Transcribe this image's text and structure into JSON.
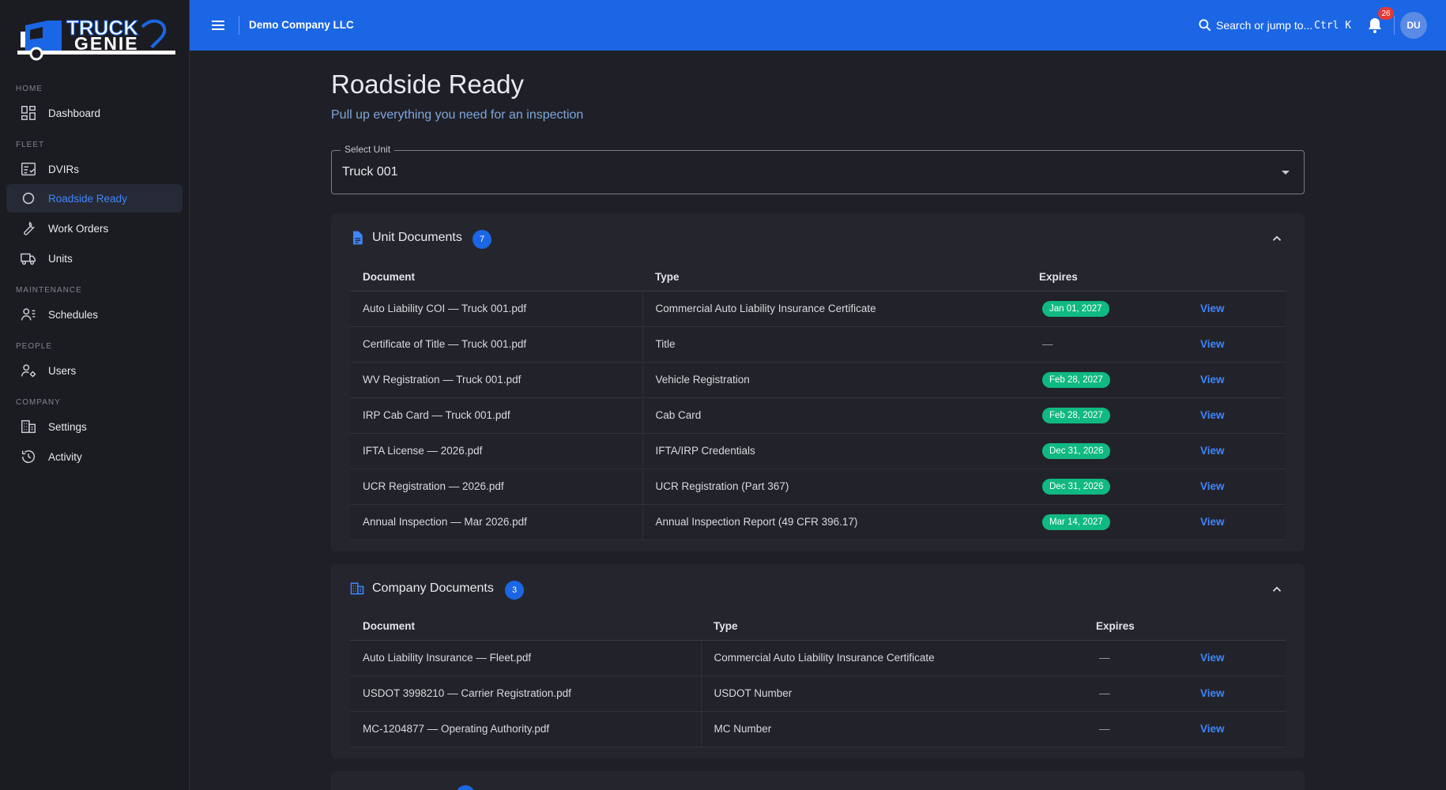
{
  "brand": {
    "line1": "TRUCK",
    "line2": "GENIE"
  },
  "sidebar": {
    "sections": [
      {
        "label": "HOME"
      },
      {
        "label": "FLEET"
      },
      {
        "label": "MAINTENANCE"
      },
      {
        "label": "PEOPLE"
      },
      {
        "label": "COMPANY"
      }
    ],
    "items": [
      {
        "label": "Dashboard",
        "icon": "dashboard-icon"
      },
      {
        "label": "DVIRs",
        "icon": "checklist-icon"
      },
      {
        "label": "Roadside Ready",
        "icon": "circle-icon",
        "active": true
      },
      {
        "label": "Work Orders",
        "icon": "wrench-icon"
      },
      {
        "label": "Units",
        "icon": "truck-icon"
      },
      {
        "label": "Schedules",
        "icon": "schedule-user-icon"
      },
      {
        "label": "Users",
        "icon": "user-gear-icon"
      },
      {
        "label": "Settings",
        "icon": "building-icon"
      },
      {
        "label": "Activity",
        "icon": "history-icon"
      }
    ]
  },
  "topbar": {
    "company": "Demo Company LLC",
    "search_label": "Search or jump to...",
    "search_shortcut": "Ctrl K",
    "notification_count": "26",
    "avatar_initials": "DU",
    "accent": "#1b66e4"
  },
  "page": {
    "title": "Roadside Ready",
    "subtitle": "Pull up everything you need for an inspection"
  },
  "select_unit": {
    "label": "Select Unit",
    "value": "Truck 001"
  },
  "unit_documents": {
    "title": "Unit Documents",
    "count": "7",
    "columns": [
      "Document",
      "Type",
      "Expires"
    ],
    "rows": [
      {
        "document": "Auto Liability COI — Truck 001.pdf",
        "type": "Commercial Auto Liability Insurance Certificate",
        "expires": "Jan 01, 2027",
        "action": "View"
      },
      {
        "document": "Certificate of Title — Truck 001.pdf",
        "type": "Title",
        "expires": "—",
        "action": "View"
      },
      {
        "document": "WV Registration — Truck 001.pdf",
        "type": "Vehicle Registration",
        "expires": "Feb 28, 2027",
        "action": "View"
      },
      {
        "document": "IRP Cab Card — Truck 001.pdf",
        "type": "Cab Card",
        "expires": "Feb 28, 2027",
        "action": "View"
      },
      {
        "document": "IFTA License — 2026.pdf",
        "type": "IFTA/IRP Credentials",
        "expires": "Dec 31, 2026",
        "action": "View"
      },
      {
        "document": "UCR Registration — 2026.pdf",
        "type": "UCR Registration (Part 367)",
        "expires": "Dec 31, 2026",
        "action": "View"
      },
      {
        "document": "Annual Inspection — Mar 2026.pdf",
        "type": "Annual Inspection Report (49 CFR 396.17)",
        "expires": "Mar 14, 2027",
        "action": "View"
      }
    ]
  },
  "company_documents": {
    "title": "Company Documents",
    "count": "3",
    "columns": [
      "Document",
      "Type",
      "Expires"
    ],
    "rows": [
      {
        "document": "Auto Liability Insurance — Fleet.pdf",
        "type": "Commercial Auto Liability Insurance Certificate",
        "expires": "—",
        "action": "View"
      },
      {
        "document": "USDOT 3998210 — Carrier Registration.pdf",
        "type": "USDOT Number",
        "expires": "—",
        "action": "View"
      },
      {
        "document": "MC-1204877 — Operating Authority.pdf",
        "type": "MC Number",
        "expires": "—",
        "action": "View"
      }
    ]
  },
  "colors": {
    "valid_badge": "#10b981",
    "link": "#3f86ff"
  }
}
